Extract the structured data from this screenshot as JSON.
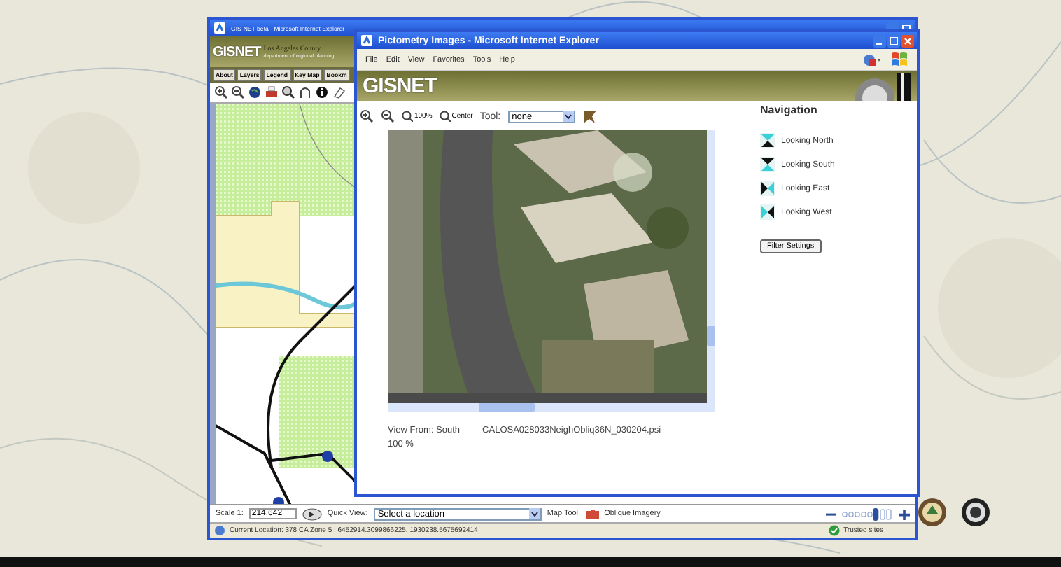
{
  "outer_window": {
    "title": "GIS-NET beta - Microsoft Internet Explorer",
    "logo": "GISNET",
    "agency": "Los Angeles County",
    "department": "department of regional planning",
    "tabs": [
      "About",
      "Layers",
      "Legend",
      "Key Map",
      "Bookm"
    ],
    "scale_label": "Scale 1:",
    "scale_value": "214,642",
    "quick_view_label": "Quick View:",
    "quick_view_value": "Select a location",
    "map_tool_label": "Map Tool:",
    "map_tool_value": "Oblique Imagery",
    "zoom_slider": {
      "level": 0.7
    },
    "status": "Current Location: 378 CA Zone 5 : 6452914.3099866225, 1930238.5675692414",
    "zone": "Trusted sites"
  },
  "inner_window": {
    "title": "Pictometry Images - Microsoft Internet Explorer",
    "menu": [
      "File",
      "Edit",
      "View",
      "Favorites",
      "Tools",
      "Help"
    ],
    "logo": "GISNET",
    "zoom_100": "100%",
    "center": "Center",
    "tool_label": "Tool:",
    "tool_value": "none",
    "view_from": "View From: South",
    "file_name": "CALOSA028033NeighObliq36N_030204.psi",
    "zoom_level": "100 %",
    "navigation": {
      "title": "Navigation",
      "items": [
        {
          "label": "Looking North",
          "kind": "north"
        },
        {
          "label": "Looking South",
          "kind": "south"
        },
        {
          "label": "Looking East",
          "kind": "east"
        },
        {
          "label": "Looking West",
          "kind": "west"
        }
      ]
    },
    "filter_button": "Filter Settings"
  }
}
